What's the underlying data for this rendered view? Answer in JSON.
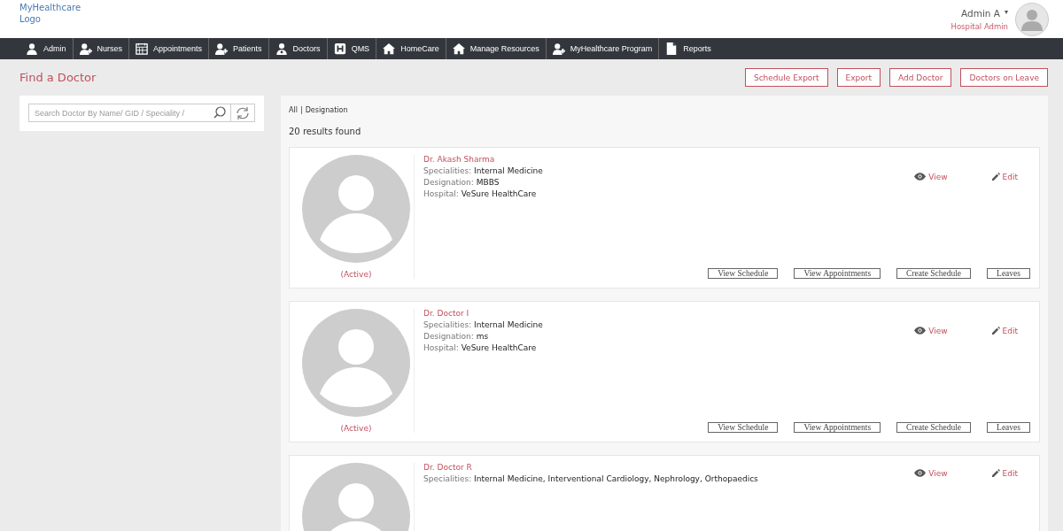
{
  "brand": {
    "name": "MyHealthcare",
    "logo": "Logo"
  },
  "user": {
    "name": "Admin A",
    "caret": "▾",
    "role": "Hospital Admin"
  },
  "nav": [
    "Admin",
    "Nurses",
    "Appointments",
    "Patients",
    "Doctors",
    "QMS",
    "HomeCare",
    "Manage Resources",
    "MyHealthcare Program",
    "Reports"
  ],
  "page_title": "Find a Doctor",
  "actions": [
    "Schedule Export",
    "Export",
    "Add Doctor",
    "Doctors on Leave"
  ],
  "search": {
    "placeholder": "Search Doctor By Name/ GID / Speciality /"
  },
  "filters": {
    "items": [
      "All",
      "Designation"
    ],
    "separator": "|"
  },
  "results": "20 results found",
  "doctors": [
    {
      "name": "Dr. Akash Sharma",
      "status": "(Active)",
      "fields": [
        {
          "label": "Specialities:",
          "value": "Internal Medicine"
        },
        {
          "label": "Designation:",
          "value": "MBBS"
        },
        {
          "label": "Hospital:",
          "value": "VeSure HealthCare"
        }
      ],
      "view": "View",
      "edit": "Edit",
      "buttons": [
        "View Schedule",
        "View Appointments",
        "Create Schedule",
        "Leaves"
      ]
    },
    {
      "name": "Dr. Doctor I",
      "status": "(Active)",
      "fields": [
        {
          "label": "Specialities:",
          "value": "Internal Medicine"
        },
        {
          "label": "Designation:",
          "value": "ms"
        },
        {
          "label": "Hospital:",
          "value": "VeSure HealthCare"
        }
      ],
      "view": "View",
      "edit": "Edit",
      "buttons": [
        "View Schedule",
        "View Appointments",
        "Create Schedule",
        "Leaves"
      ]
    },
    {
      "name": "Dr. Doctor R",
      "fields": [
        {
          "label": "Specialities:",
          "value": "Internal Medicine, Interventional Cardiology, Nephrology, Orthopaedics"
        }
      ],
      "view": "View",
      "edit": "Edit"
    }
  ]
}
